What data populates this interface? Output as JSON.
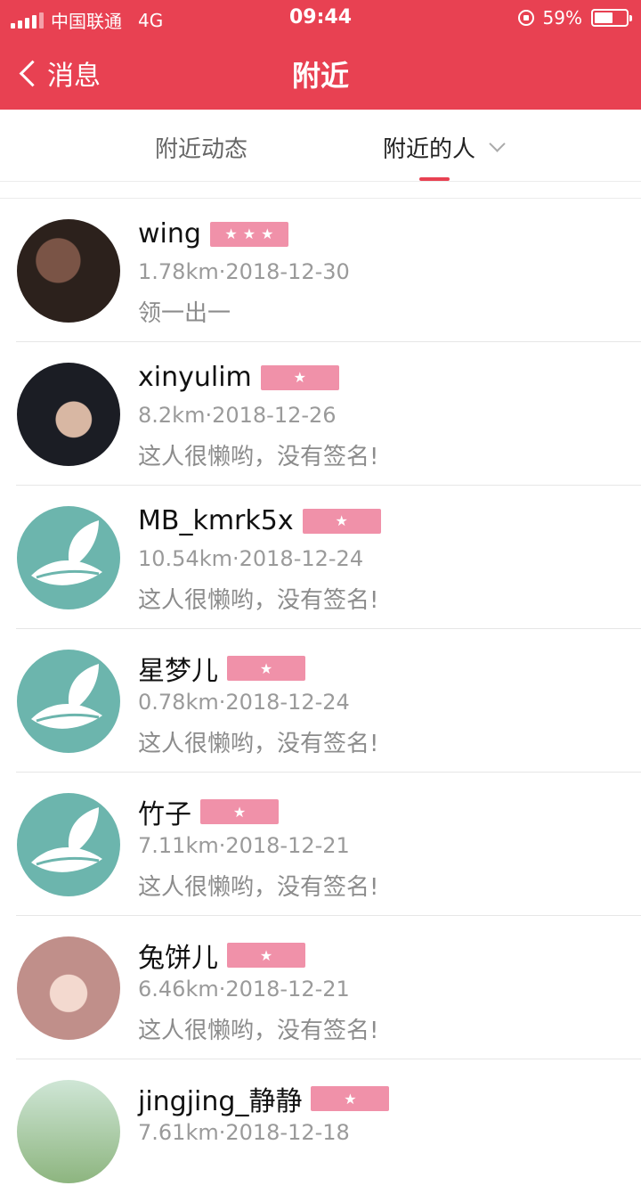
{
  "status_bar": {
    "carrier": "中国联通",
    "network": "4G",
    "time": "09:44",
    "battery": "59%",
    "battery_level": 0.59
  },
  "header": {
    "back_label": "消息",
    "title": "附近",
    "color": "#e84152"
  },
  "tabs": [
    {
      "label": "附近动态",
      "active": false
    },
    {
      "label": "附近的人",
      "active": true
    }
  ],
  "users": [
    {
      "name": "wing",
      "stars": "★★★",
      "meta": "1.78km·2018-12-30",
      "signature": "领一出一"
    },
    {
      "name": "xinyulim",
      "stars": "★",
      "meta": "8.2km·2018-12-26",
      "signature": "这人很懒哟，没有签名!"
    },
    {
      "name": "MB_kmrk5x",
      "stars": "★",
      "meta": "10.54km·2018-12-24",
      "signature": "这人很懒哟，没有签名!"
    },
    {
      "name": "星梦儿",
      "stars": "★",
      "meta": "0.78km·2018-12-24",
      "signature": "这人很懒哟，没有签名!"
    },
    {
      "name": "竹子",
      "stars": "★",
      "meta": "7.11km·2018-12-21",
      "signature": "这人很懒哟，没有签名!"
    },
    {
      "name": "兔饼儿",
      "stars": "★",
      "meta": "6.46km·2018-12-21",
      "signature": "这人很懒哟，没有签名!"
    },
    {
      "name": "jingjing_静静",
      "stars": "★",
      "meta": "7.61km·2018-12-18",
      "signature": ""
    }
  ]
}
